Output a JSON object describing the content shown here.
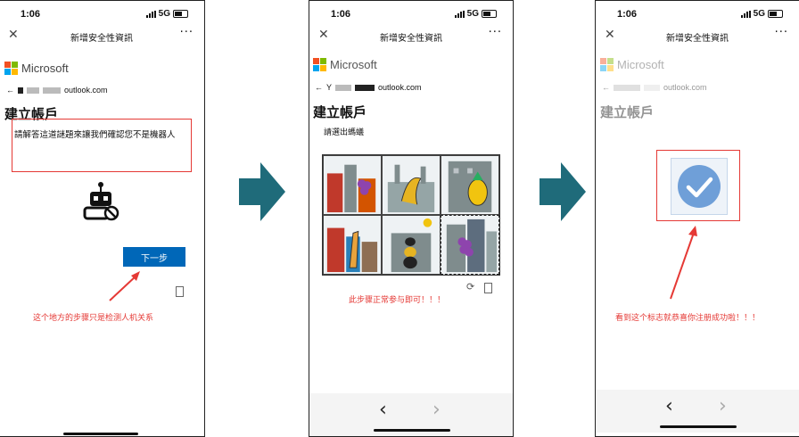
{
  "status": {
    "time": "1:06",
    "network": "5G"
  },
  "nav": {
    "title": "新增安全性資訊",
    "more": "···",
    "close": "✕"
  },
  "brand": {
    "name": "Microsoft"
  },
  "screen1": {
    "email_visible": "outlook.com",
    "heading": "建立帳戶",
    "instruction": "請解答這道謎題來讓我們確認您不是機器人",
    "next_button": "下一步",
    "annotation": "这个地方的步骤只是检测人机关系"
  },
  "screen2": {
    "email_prefix": "Y",
    "email_visible": "outlook.com",
    "heading": "建立帳戶",
    "prompt": "請選出螞蟻",
    "annotation": "此步骤正常参与即可！！！"
  },
  "screen3": {
    "email_visible": "outlook.com",
    "heading": "建立帳戶",
    "annotation": "看到这个标志就恭喜你注册成功啦！！！"
  },
  "colors": {
    "accent": "#0067b8",
    "annotation_red": "#e53935",
    "step_arrow": "#1f6b7a",
    "check_blue": "#6f9fd8"
  },
  "bottom_nav": {
    "back": "‹",
    "forward": "›"
  }
}
